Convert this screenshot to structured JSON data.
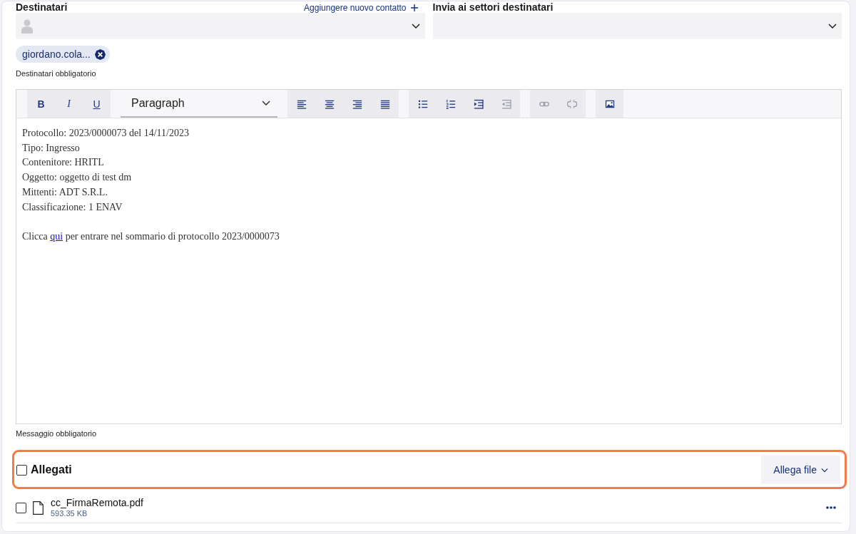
{
  "recipients": {
    "label": "Destinatari",
    "add_contact": "Aggiungere nuovo contatto",
    "chips": [
      {
        "label": "giordano.cola..."
      }
    ],
    "hint": "Destinatari obbligatorio"
  },
  "sectors": {
    "label": "Invia ai settori destinatari"
  },
  "editor": {
    "toolbar": {
      "groups": [
        {
          "buttons": [
            {
              "kind": "bold",
              "label": "B",
              "disabled": false
            },
            {
              "kind": "italic",
              "label": "I",
              "disabled": false
            },
            {
              "kind": "underline",
              "label": "U",
              "disabled": false
            }
          ]
        },
        {
          "buttons": [
            {
              "kind": "format",
              "label": "Paragraph"
            }
          ]
        },
        {
          "buttons": [
            {
              "kind": "alignleft",
              "disabled": false
            },
            {
              "kind": "aligncenter",
              "disabled": false
            },
            {
              "kind": "alignright",
              "disabled": false
            },
            {
              "kind": "justify",
              "disabled": false
            }
          ]
        },
        {
          "buttons": [
            {
              "kind": "bullets",
              "disabled": false
            },
            {
              "kind": "numbers",
              "disabled": false
            },
            {
              "kind": "indent",
              "disabled": false
            },
            {
              "kind": "outdent",
              "disabled": true
            }
          ]
        },
        {
          "buttons": [
            {
              "kind": "link",
              "disabled": true
            },
            {
              "kind": "unlink",
              "disabled": true
            }
          ]
        },
        {
          "buttons": [
            {
              "kind": "image",
              "disabled": false
            }
          ]
        }
      ]
    },
    "paragraphs": [
      {
        "lines": [
          "Protocollo: 2023/0000073 del 14/11/2023",
          "Tipo: Ingresso",
          "Contenitore: HRITL",
          "Oggetto: oggetto di test dm",
          "Mittenti: ADT S.R.L.",
          "Classificazione: 1 ENAV"
        ]
      },
      {
        "before": "Clicca ",
        "link": "qui",
        "after": " per entrare nel sommario di protocollo 2023/0000073"
      }
    ],
    "hint": "Messaggio obbligatorio"
  },
  "attachments": {
    "label": "Allegati",
    "checked": false,
    "highlighted": true,
    "button": "Allega file",
    "files": [
      {
        "name": "cc_FirmaRemota.pdf",
        "size": "593.35 KB",
        "checked": false
      }
    ]
  }
}
